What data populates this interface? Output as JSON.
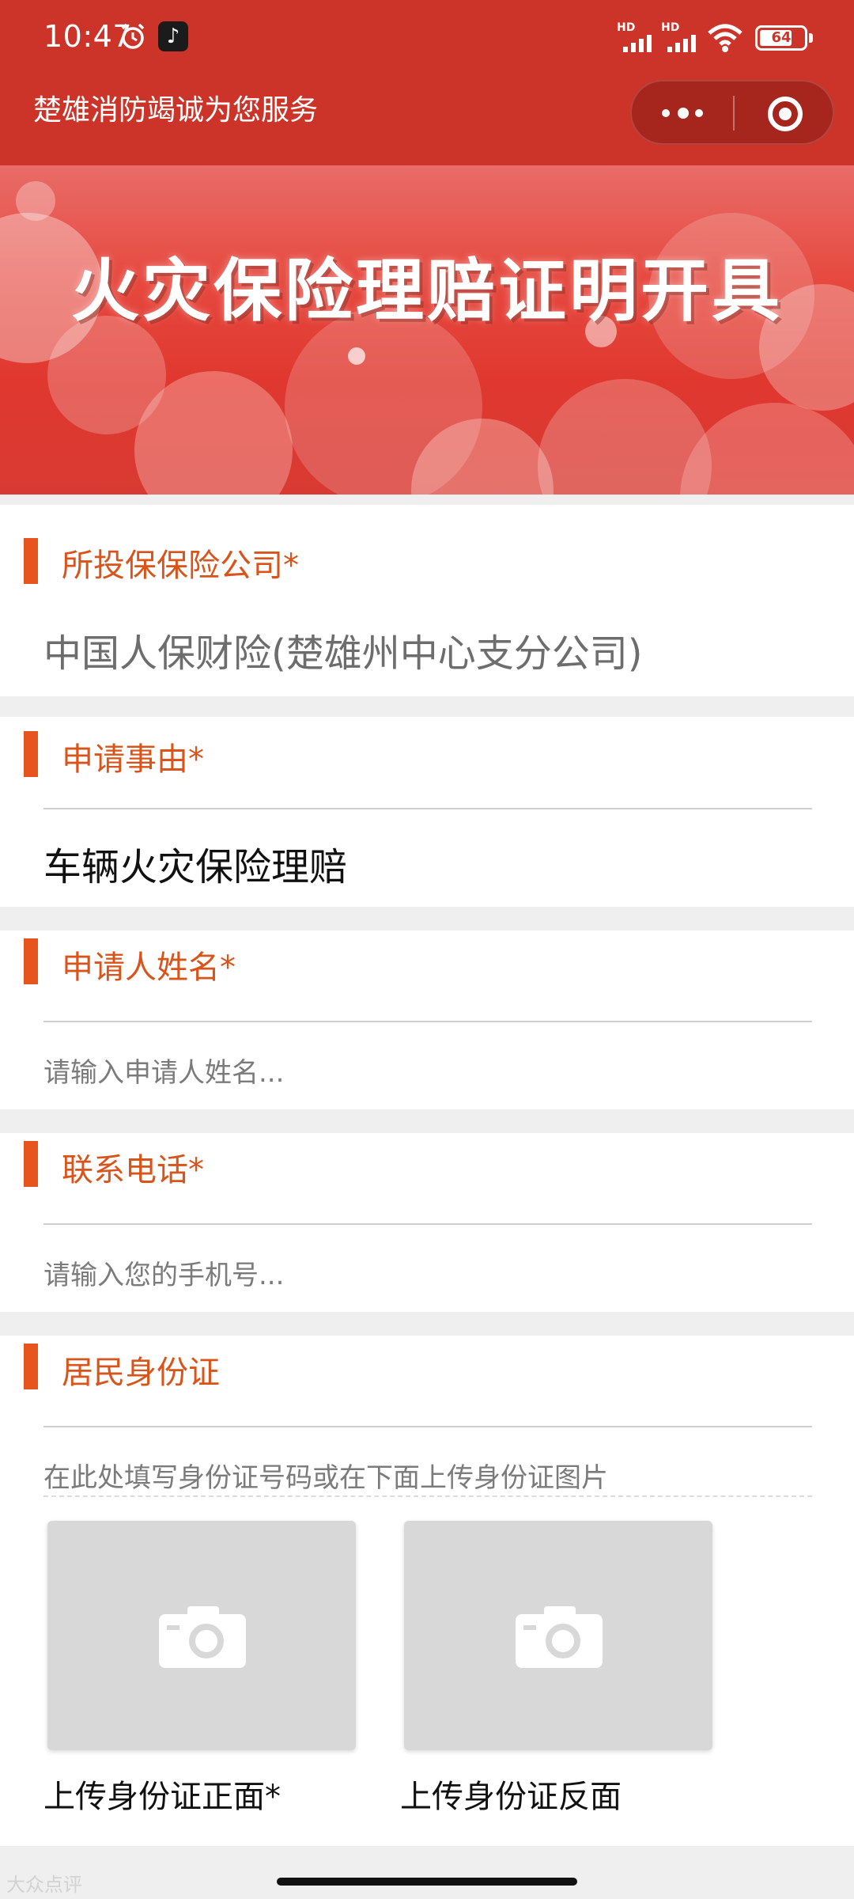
{
  "status_bar": {
    "time": "10:47",
    "battery": "64",
    "network_labels": [
      "HD",
      "HD"
    ]
  },
  "nav": {
    "title": "楚雄消防竭诚为您服务"
  },
  "banner": {
    "title": "火灾保险理赔证明开具"
  },
  "form": {
    "insurance_company": {
      "label": "所投保保险公司*",
      "value": "中国人保财险(楚雄州中心支分公司)"
    },
    "reason": {
      "label": "申请事由*",
      "value": "车辆火灾保险理赔"
    },
    "applicant_name": {
      "label": "申请人姓名*",
      "placeholder": "请输入申请人姓名..."
    },
    "phone": {
      "label": "联系电话*",
      "placeholder": "请输入您的手机号..."
    },
    "id_card": {
      "label": "居民身份证",
      "placeholder": "在此处填写身份证号码或在下面上传身份证图片",
      "upload_front_label": "上传身份证正面*",
      "upload_back_label": "上传身份证反面"
    }
  },
  "watermark": "大众点评",
  "colors": {
    "theme_red": "#cc3429",
    "label_orange": "#d9541a",
    "marker_orange": "#e8541e"
  },
  "icons": [
    "alarm-icon",
    "tiktok-icon",
    "signal-icon",
    "wifi-icon",
    "battery-icon",
    "more-icon",
    "close-icon",
    "camera-icon"
  ]
}
